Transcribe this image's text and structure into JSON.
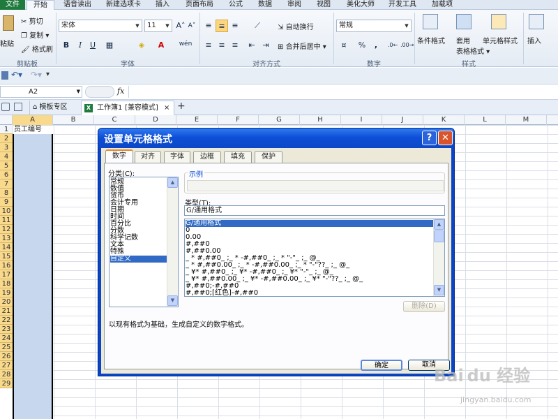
{
  "ribbon_tabs": [
    "文件",
    "开始",
    "语音读出",
    "新建选项卡",
    "插入",
    "页面布局",
    "公式",
    "数据",
    "审阅",
    "视图",
    "美化大师",
    "开发工具",
    "加载项"
  ],
  "clipboard": {
    "paste": "粘贴",
    "cut": "剪切",
    "copy": "复制",
    "format_painter": "格式刷",
    "group": "剪贴板"
  },
  "font": {
    "name": "宋体",
    "size": "11",
    "group": "字体",
    "bold": "B",
    "italic": "I",
    "underline": "U",
    "grow": "A˄",
    "shrink": "A˅",
    "wen": "wén"
  },
  "alignment": {
    "wrap": "自动换行",
    "merge": "合并后居中",
    "group": "对齐方式"
  },
  "number": {
    "format": "常规",
    "group": "数字",
    "percent": "%",
    "comma": ","
  },
  "styles": {
    "conditional": "条件格式",
    "table_a": "套用",
    "table_b": "表格格式",
    "cell_styles": "单元格样式",
    "group": "样式"
  },
  "cells": {
    "insert": "插入"
  },
  "namebox": "A2",
  "fx": "fx",
  "workbook_tabs": {
    "template": "模板专区",
    "sheet": "工作簿1",
    "mode": "[兼容模式]",
    "close": "×",
    "add": "+"
  },
  "columns": [
    "A",
    "B",
    "C",
    "D",
    "E",
    "F",
    "G",
    "H",
    "I",
    "J",
    "K",
    "L",
    "M"
  ],
  "rows": [
    "1",
    "2",
    "3",
    "4",
    "5",
    "6",
    "7",
    "8",
    "9",
    "10",
    "11",
    "12",
    "13",
    "14",
    "15",
    "16",
    "17",
    "18",
    "19",
    "20",
    "21",
    "22",
    "23",
    "24",
    "25",
    "26",
    "27",
    "28",
    "29"
  ],
  "cell_a1": "员工编号",
  "dialog": {
    "title": "设置单元格格式",
    "help": "?",
    "close": "✕",
    "tabs": [
      "数字",
      "对齐",
      "字体",
      "边框",
      "填充",
      "保护"
    ],
    "category_label": "分类(C):",
    "categories": [
      "常规",
      "数值",
      "货币",
      "会计专用",
      "日期",
      "时间",
      "百分比",
      "分数",
      "科学记数",
      "文本",
      "特殊",
      "自定义"
    ],
    "selected_category": "自定义",
    "sample_label": "示例",
    "type_label": "类型(T):",
    "type_value": "G/通用格式",
    "formats": [
      "G/通用格式",
      "0",
      "0.00",
      "#,##0",
      "#,##0.00",
      "_ * #,##0_ ;_ * -#,##0_ ;_ * \"-\"_ ;_ @_",
      "_ * #,##0.00_ ;_ * -#,##0.00_ ;_ * \"-\"??_ ;_ @_",
      "_ ¥* #,##0_ ;_ ¥* -#,##0_ ;_ ¥* \"-\"_ ;_ @_",
      "_ ¥* #,##0.00_ ;_ ¥* -#,##0.00_ ;_ ¥* \"-\"??_ ;_ @_",
      "#,##0;-#,##0",
      "#,##0;[红色]-#,##0"
    ],
    "delete": "删除(D)",
    "description": "以现有格式为基础，生成自定义的数字格式。",
    "ok": "确定",
    "cancel": "取消"
  },
  "watermark": {
    "brand": "Bai du 经验",
    "url": "jingyan.baidu.com"
  }
}
